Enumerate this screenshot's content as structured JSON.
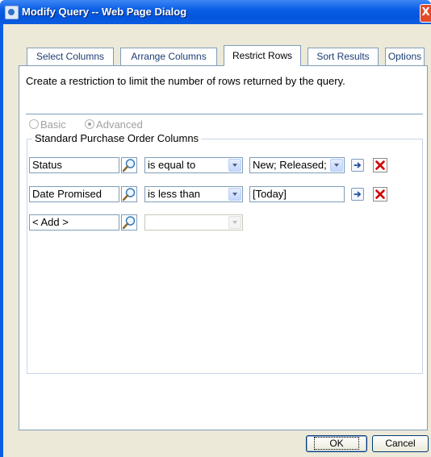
{
  "window": {
    "title": "Modify Query -- Web Page Dialog",
    "close_glyph": "X"
  },
  "tabs": [
    {
      "label": "Select Columns",
      "active": false
    },
    {
      "label": "Arrange Columns",
      "active": false
    },
    {
      "label": "Restrict Rows",
      "active": true
    },
    {
      "label": "Sort Results",
      "active": false
    },
    {
      "label": "Options",
      "active": false
    }
  ],
  "description": "Create a restriction to limit the number of rows returned by the query.",
  "mode": {
    "basic_label": "Basic",
    "advanced_label": "Advanced",
    "selected": "Advanced"
  },
  "group": {
    "legend": "Standard Purchase Order Columns",
    "rows": [
      {
        "column": "Status",
        "operator": "is equal to",
        "value": "New; Released;"
      },
      {
        "column": "Date Promised",
        "operator": "is less than",
        "value": "[Today]"
      },
      {
        "column": "< Add >",
        "operator": "",
        "value": ""
      }
    ]
  },
  "buttons": {
    "ok": "OK",
    "cancel": "Cancel"
  },
  "colors": {
    "title_bar": "#0a5ee6",
    "delete_icon": "#d40000",
    "go_arrow": "#1f4f9c",
    "panel_border": "#7f9db9"
  }
}
